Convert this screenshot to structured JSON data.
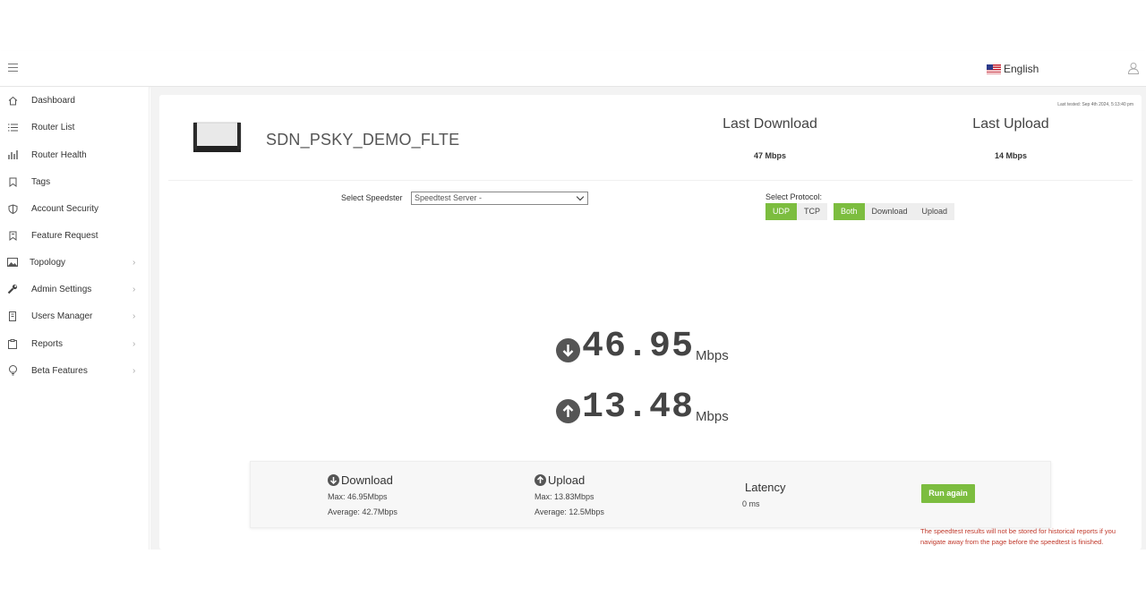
{
  "topbar": {
    "menu_icon": "hamburger-icon",
    "language": "English",
    "language_flag_icon": "us-flag-icon",
    "user_icon": "user-icon"
  },
  "sidebar": {
    "items": [
      {
        "label": "Dashboard",
        "icon": "home-icon",
        "has_submenu": false
      },
      {
        "label": "Router List",
        "icon": "list-icon",
        "has_submenu": false
      },
      {
        "label": "Router Health",
        "icon": "bar-chart-icon",
        "has_submenu": false
      },
      {
        "label": "Tags",
        "icon": "tag-icon",
        "has_submenu": false
      },
      {
        "label": "Account Security",
        "icon": "shield-icon",
        "has_submenu": false
      },
      {
        "label": "Feature Request",
        "icon": "bookmark-icon",
        "has_submenu": false
      },
      {
        "label": "Topology",
        "icon": "image-icon",
        "has_submenu": true
      },
      {
        "label": "Admin Settings",
        "icon": "wrench-icon",
        "has_submenu": true
      },
      {
        "label": "Users Manager",
        "icon": "device-icon",
        "has_submenu": true
      },
      {
        "label": "Reports",
        "icon": "clipboard-icon",
        "has_submenu": true
      },
      {
        "label": "Beta Features",
        "icon": "lightbulb-icon",
        "has_submenu": true
      }
    ]
  },
  "header": {
    "last_tested": "Last tested: Sep 4th 2024, 5:13:40 pm",
    "router_name": "SDN_PSKY_DEMO_FLTE",
    "last_download_title": "Last Download",
    "last_download_value": "47 Mbps",
    "last_upload_title": "Last Upload",
    "last_upload_value": "14 Mbps"
  },
  "controls": {
    "speedster_label": "Select Speedster",
    "speedster_value": "Speedtest Server -",
    "protocol_label": "Select Protocol:",
    "protocol_options": [
      "UDP",
      "TCP"
    ],
    "protocol_selected": "UDP",
    "direction_options": [
      "Both",
      "Download",
      "Upload"
    ],
    "direction_selected": "Both",
    "accent_color": "#7cbd3f"
  },
  "results": {
    "download_value": "46.95",
    "download_unit": "Mbps",
    "upload_value": "13.48",
    "upload_unit": "Mbps"
  },
  "summary": {
    "download_title": "Download",
    "download_max": "Max: 46.95Mbps",
    "download_avg": "Average: 42.7Mbps",
    "upload_title": "Upload",
    "upload_max": "Max: 13.83Mbps",
    "upload_avg": "Average: 12.5Mbps",
    "latency_title": "Latency",
    "latency_value": "0 ms",
    "run_again_label": "Run again"
  },
  "warning": "The speedtest results will not be stored for historical reports if you navigate away from the page before the speedtest is finished."
}
